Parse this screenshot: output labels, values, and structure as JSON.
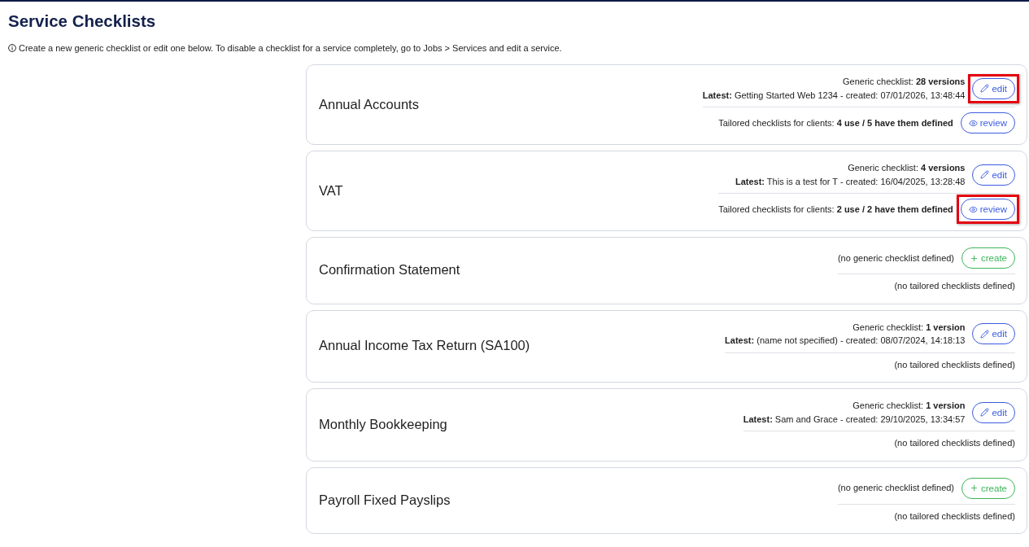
{
  "page": {
    "title": "Service Checklists",
    "info": "Create a new generic checklist or edit one below. To disable a checklist for a service completely, go to Jobs > Services and edit a service."
  },
  "services": [
    {
      "name": "Annual Accounts",
      "generic": {
        "lines": [
          "Generic checklist: **28 versions**",
          "**Latest:** Getting Started Web 1234 - created: 07/01/2026, 13:48:44"
        ],
        "button": {
          "kind": "edit",
          "label": "edit",
          "highlighted": true
        }
      },
      "tailored": {
        "lines": [
          "Tailored checklists for clients: **4 use / 5 have them defined**"
        ],
        "button": {
          "kind": "review",
          "label": "review",
          "highlighted": false
        }
      }
    },
    {
      "name": "VAT",
      "generic": {
        "lines": [
          "Generic checklist: **4 versions**",
          "**Latest:** This is a test for T - created: 16/04/2025, 13:28:48"
        ],
        "button": {
          "kind": "edit",
          "label": "edit",
          "highlighted": false
        }
      },
      "tailored": {
        "lines": [
          "Tailored checklists for clients: **2 use / 2 have them defined**"
        ],
        "button": {
          "kind": "review",
          "label": "review",
          "highlighted": true
        }
      }
    },
    {
      "name": "Confirmation Statement",
      "generic": {
        "lines": [
          "(no generic checklist defined)"
        ],
        "button": {
          "kind": "create",
          "label": "create",
          "highlighted": false
        }
      },
      "tailored": {
        "lines": [
          "(no tailored checklists defined)"
        ]
      }
    },
    {
      "name": "Annual Income Tax Return (SA100)",
      "generic": {
        "lines": [
          "Generic checklist: **1 version**",
          "**Latest:** (name not specified) - created: 08/07/2024, 14:18:13"
        ],
        "button": {
          "kind": "edit",
          "label": "edit",
          "highlighted": false
        }
      },
      "tailored": {
        "lines": [
          "(no tailored checklists defined)"
        ]
      }
    },
    {
      "name": "Monthly Bookkeeping",
      "generic": {
        "lines": [
          "Generic checklist: **1 version**",
          "**Latest:** Sam and Grace - created: 29/10/2025, 13:34:57"
        ],
        "button": {
          "kind": "edit",
          "label": "edit",
          "highlighted": false
        }
      },
      "tailored": {
        "lines": [
          "(no tailored checklists defined)"
        ]
      }
    },
    {
      "name": "Payroll Fixed Payslips",
      "generic": {
        "lines": [
          "(no generic checklist defined)"
        ],
        "button": {
          "kind": "create",
          "label": "create",
          "highlighted": false
        }
      },
      "tailored": {
        "lines": [
          "(no tailored checklists defined)"
        ]
      }
    }
  ]
}
